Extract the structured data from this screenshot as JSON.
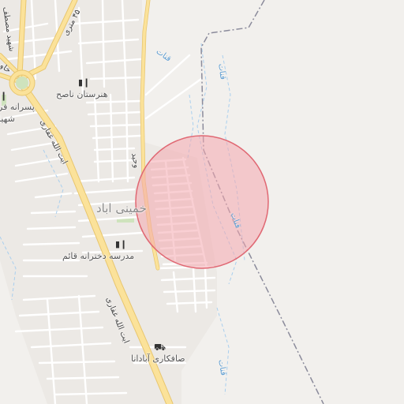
{
  "map": {
    "district": "خمینی اباد",
    "pois": [
      {
        "id": "school-naseh",
        "label": "هنرستان ناصح",
        "icon": "school-icon"
      },
      {
        "id": "school-ghaem",
        "label": "مدرسه دخترانه قائم",
        "icon": "school-icon"
      },
      {
        "id": "garage-abadana",
        "label": "صافکاری آبادانا",
        "icon": "car-icon"
      },
      {
        "id": "school-left",
        "label": "پسرانه فر",
        "icon": "school-icon"
      },
      {
        "id": "left-shahid",
        "label": "شهیا"
      }
    ],
    "roads": {
      "ghaffari_top": "ایت الله غفاری",
      "ghaffari_bottom": "ایت الله غفاری",
      "metri45": "۴۵ متری",
      "shahid_mostafa": "شهید مصطف",
      "khavaran": "خاو",
      "vahid": "وحید"
    },
    "water": [
      "قنات",
      "قنات",
      "قنات",
      "قنات"
    ],
    "highlight": {
      "type": "circle",
      "fill": "#f4a8ae",
      "stroke": "#e06873"
    }
  }
}
